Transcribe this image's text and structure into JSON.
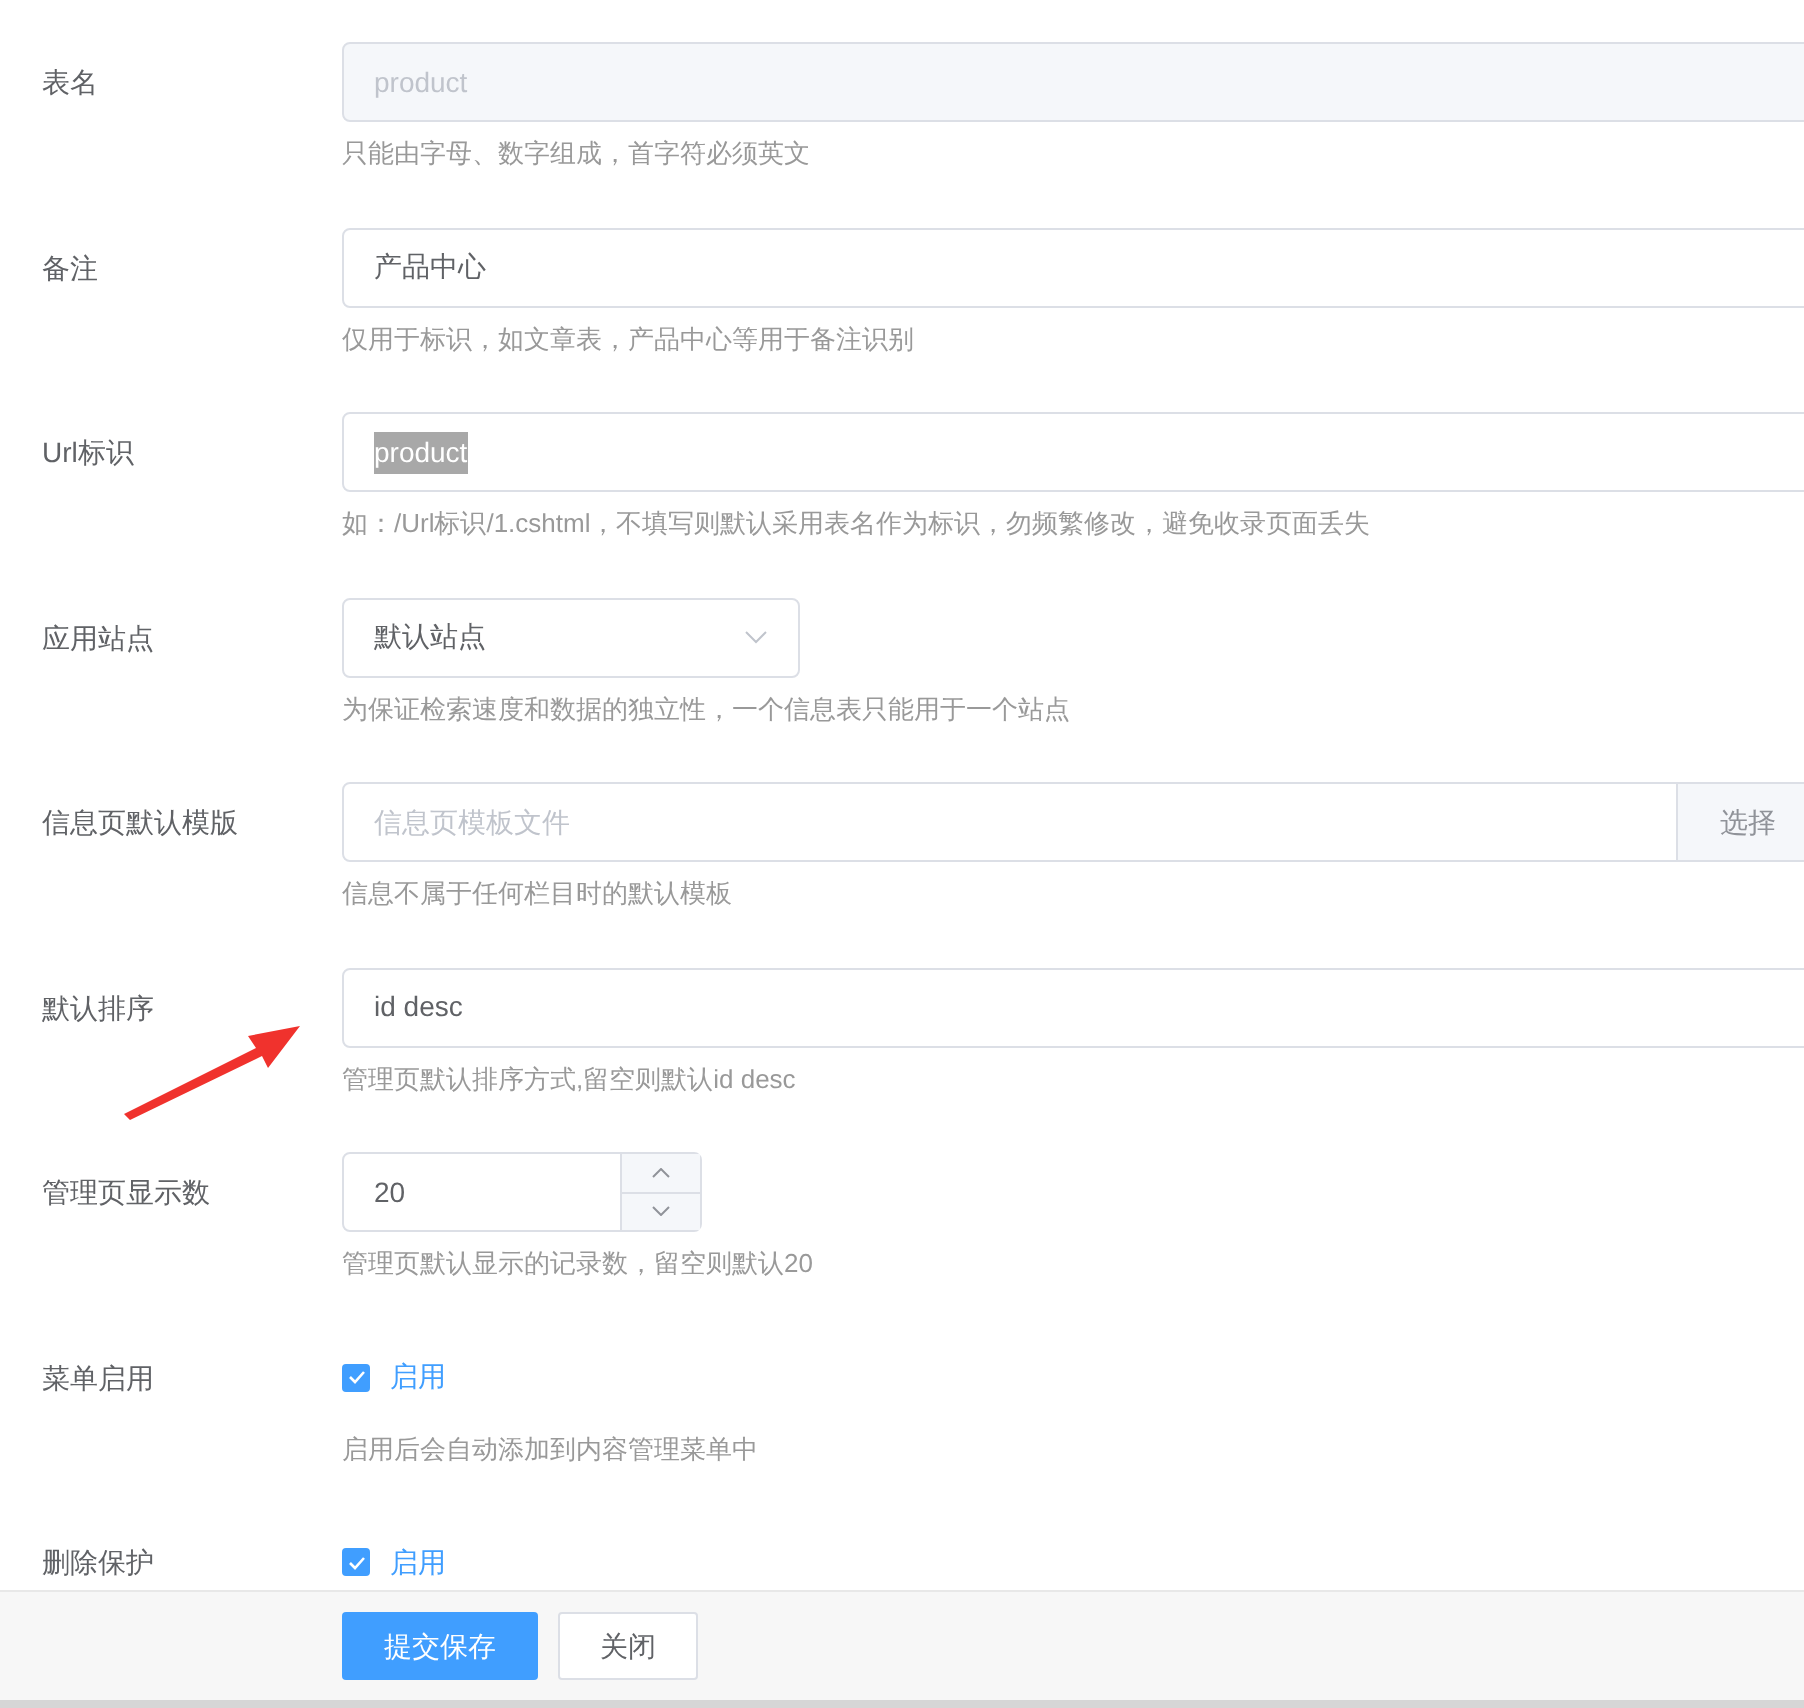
{
  "form_rows": [
    {
      "kind": "text",
      "label": "表名",
      "value": "product",
      "disabled": true,
      "highlighted": false,
      "hint": "只能由字母、数字组成，首字符必须英文"
    },
    {
      "kind": "text",
      "label": "备注",
      "value": "产品中心",
      "disabled": false,
      "highlighted": false,
      "hint": "仅用于标识，如文章表，产品中心等用于备注识别"
    },
    {
      "kind": "text",
      "label": "Url标识",
      "value": "product",
      "disabled": false,
      "highlighted": true,
      "hint": "如：/Url标识/1.cshtml，不填写则默认采用表名作为标识，勿频繁修改，避免收录页面丢失"
    },
    {
      "kind": "select",
      "label": "应用站点",
      "value": "默认站点",
      "hint": "为保证检索速度和数据的独立性，一个信息表只能用于一个站点"
    },
    {
      "kind": "picker",
      "label": "信息页默认模版",
      "placeholder": "信息页模板文件",
      "button": "选择",
      "hint": "信息不属于任何栏目时的默认模板"
    },
    {
      "kind": "text",
      "label": "默认排序",
      "value": "id desc",
      "disabled": false,
      "highlighted": false,
      "hint": "管理页默认排序方式,留空则默认id desc"
    },
    {
      "kind": "number",
      "label": "管理页显示数",
      "value": "20",
      "hint": "管理页默认显示的记录数，留空则默认20"
    },
    {
      "kind": "checkbox",
      "label": "菜单启用",
      "option": "启用",
      "checked": true,
      "hint": "启用后会自动添加到内容管理菜单中"
    },
    {
      "kind": "checkbox",
      "label": "删除保护",
      "option": "启用",
      "checked": true
    }
  ],
  "footer": {
    "buttons": [
      {
        "kind": "primary",
        "label": "提交保存"
      },
      {
        "kind": "default",
        "label": "关闭"
      }
    ]
  }
}
